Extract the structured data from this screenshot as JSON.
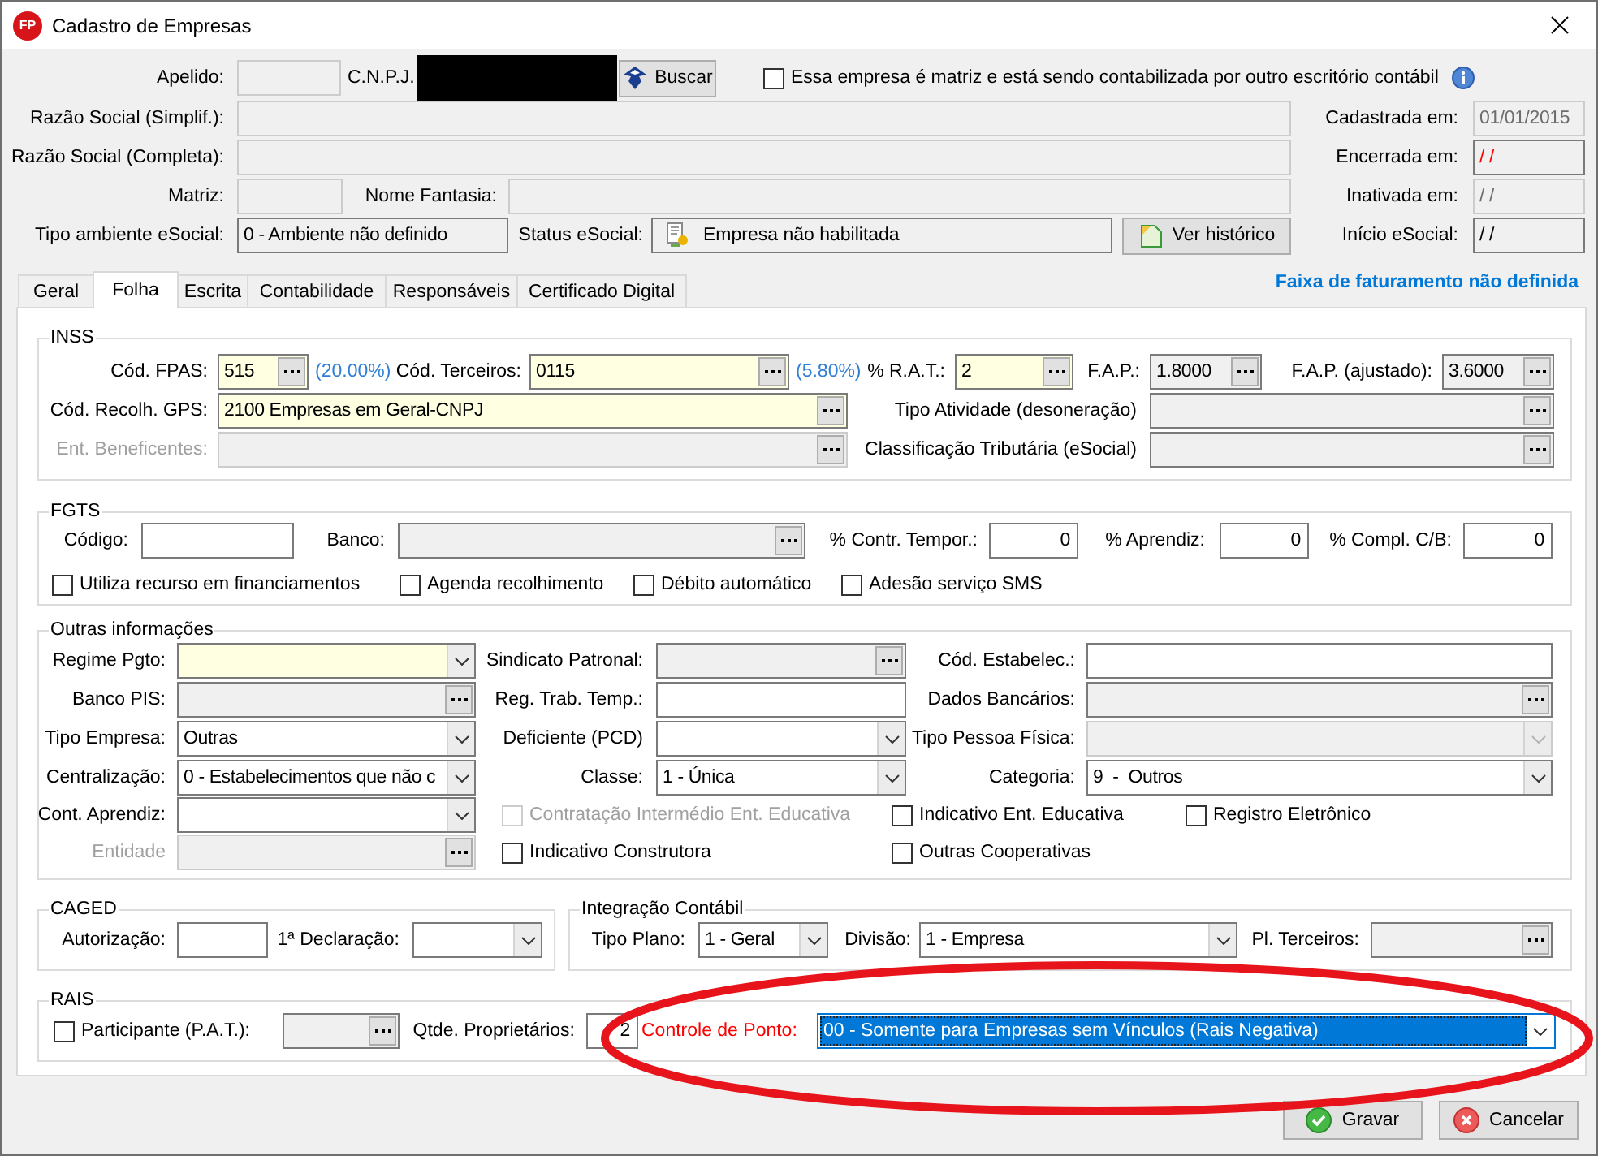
{
  "window": {
    "logo": "FP",
    "title": "Cadastro de Empresas"
  },
  "header": {
    "apelido": {
      "label": "Apelido:",
      "readonly": true,
      "disabled": true
    },
    "cnpj": {
      "label": "C.N.P.J.",
      "redacted": true
    },
    "search_button": {
      "label": "Buscar"
    },
    "matriz_option": {
      "label": "Essa empresa é matriz e está sendo contabilizada por outro escritório contábil",
      "checked": false
    },
    "razao_simplificada": {
      "label": "Razão Social (Simplif.):",
      "readonly": true,
      "disabled": true
    },
    "razao_completa": {
      "label": "Razão Social (Completa):",
      "readonly": true,
      "disabled": true
    },
    "matriz": {
      "label": "Matriz:",
      "readonly": true,
      "disabled": true
    },
    "nome_fantasia": {
      "label": "Nome Fantasia:",
      "readonly": true,
      "disabled": true
    },
    "tipo_ambiente": {
      "label": "Tipo ambiente eSocial:",
      "value": "0 - Ambiente não definido",
      "readonly": true,
      "disabled": false
    },
    "status_esocial": {
      "label": "Status eSocial:",
      "value": "Empresa não habilitada"
    },
    "history_button": {
      "label": "Ver histórico"
    },
    "dates": [
      {
        "label": "Cadastrada em:",
        "value": "01/01/2015",
        "readonly": true,
        "disabled": true,
        "alert": false
      },
      {
        "label": "Encerrada em:",
        "value": "/ /",
        "readonly": true,
        "disabled": false,
        "alert": true
      },
      {
        "label": "Inativada em:",
        "value": "/ /",
        "readonly": true,
        "disabled": true,
        "alert": false
      },
      {
        "label": "Início eSocial:",
        "value": "/ /",
        "readonly": true,
        "disabled": false,
        "alert": false
      }
    ]
  },
  "tabs": [
    {
      "label": "Geral",
      "selected": false
    },
    {
      "label": "Folha",
      "selected": true
    },
    {
      "label": "Escrita",
      "selected": false
    },
    {
      "label": "Contabilidade",
      "selected": false
    },
    {
      "label": "Responsáveis",
      "selected": false
    },
    {
      "label": "Certificado Digital",
      "selected": false
    }
  ],
  "billing_notice": "Faixa de faturamento não definida",
  "inss": {
    "title": "INSS",
    "rows": [
      [
        {
          "kind": "lookup",
          "label": "Cód. FPAS:",
          "value": "515",
          "required": true,
          "readonly": false,
          "disabled": false,
          "note": "(20.00%)",
          "label_dimmed": false
        },
        {
          "kind": "lookup",
          "label": "Cód. Terceiros:",
          "value": "0115",
          "required": true,
          "readonly": false,
          "disabled": false,
          "note": "(5.80%)",
          "label_dimmed": false
        },
        {
          "kind": "lookup",
          "label": "% R.A.T.:",
          "value": "2",
          "required": true,
          "readonly": false,
          "disabled": false,
          "label_dimmed": false
        },
        {
          "kind": "lookup",
          "label": "F.A.P.:",
          "value": "1.8000",
          "required": false,
          "readonly": true,
          "disabled": false,
          "label_dimmed": false
        },
        {
          "kind": "lookup",
          "label": "F.A.P. (ajustado):",
          "value": "3.6000",
          "required": false,
          "readonly": true,
          "disabled": false,
          "label_dimmed": false
        }
      ],
      [
        {
          "kind": "lookup",
          "label": "Cód. Recolh. GPS:",
          "value": "2100 Empresas em Geral-CNPJ",
          "required": true,
          "readonly": false,
          "disabled": false,
          "label_dimmed": false
        },
        {
          "kind": "lookup",
          "label": "Tipo Atividade (desoneração)",
          "required": false,
          "readonly": true,
          "disabled": false,
          "label_dimmed": false
        }
      ],
      [
        {
          "kind": "lookup",
          "label": "Ent. Beneficentes:",
          "required": false,
          "readonly": true,
          "disabled": true,
          "label_dimmed": true
        },
        {
          "kind": "lookup",
          "label": "Classificação Tributária (eSocial)",
          "required": false,
          "readonly": true,
          "disabled": false,
          "label_dimmed": false
        }
      ]
    ]
  },
  "fgts": {
    "title": "FGTS",
    "fields": [
      {
        "kind": "text",
        "label": "Código:",
        "required": false,
        "readonly": false,
        "disabled": false
      },
      {
        "kind": "lookup",
        "label": "Banco:",
        "required": false,
        "readonly": true,
        "disabled": false
      },
      {
        "kind": "number",
        "label": "% Contr. Tempor.:",
        "value": "0",
        "required": false,
        "readonly": false,
        "disabled": false
      },
      {
        "kind": "number",
        "label": "% Aprendiz:",
        "value": "0",
        "required": false,
        "readonly": false,
        "disabled": false
      },
      {
        "kind": "number",
        "label": "% Compl. C/B:",
        "value": "0",
        "required": false,
        "readonly": false,
        "disabled": false
      }
    ],
    "options": [
      {
        "label": "Utiliza recurso em financiamentos",
        "checked": false
      },
      {
        "label": "Agenda recolhimento",
        "checked": false
      },
      {
        "label": "Débito automático",
        "checked": false
      },
      {
        "label": "Adesão serviço SMS",
        "checked": false
      }
    ]
  },
  "outras": {
    "title": "Outras informações",
    "rows": [
      [
        {
          "kind": "select",
          "label": "Regime Pgto:",
          "required": true,
          "readonly": false,
          "disabled": false,
          "label_dimmed": false
        },
        {
          "kind": "lookup",
          "label": "Sindicato Patronal:",
          "required": false,
          "readonly": true,
          "disabled": false,
          "label_dimmed": false
        },
        {
          "kind": "text",
          "label": "Cód. Estabelec.:",
          "required": false,
          "readonly": false,
          "disabled": false,
          "label_dimmed": false
        }
      ],
      [
        {
          "kind": "lookup",
          "label": "Banco PIS:",
          "required": false,
          "readonly": true,
          "disabled": false,
          "label_dimmed": false
        },
        {
          "kind": "text",
          "label": "Reg. Trab. Temp.:",
          "required": false,
          "readonly": false,
          "disabled": false,
          "label_dimmed": false
        },
        {
          "kind": "lookup",
          "label": "Dados Bancários:",
          "required": false,
          "readonly": true,
          "disabled": false,
          "label_dimmed": false
        }
      ],
      [
        {
          "kind": "select",
          "label": "Tipo Empresa:",
          "value": "Outras",
          "required": false,
          "readonly": false,
          "disabled": false,
          "label_dimmed": false
        },
        {
          "kind": "select",
          "label": "Deficiente (PCD)",
          "required": false,
          "readonly": false,
          "disabled": false,
          "label_dimmed": false
        },
        {
          "kind": "select",
          "label": "Tipo Pessoa Física:",
          "required": false,
          "readonly": true,
          "disabled": true,
          "label_dimmed": false
        }
      ],
      [
        {
          "kind": "select",
          "label": "Centralização:",
          "value": "0 - Estabelecimentos que não c",
          "required": false,
          "readonly": false,
          "disabled": false,
          "label_dimmed": false
        },
        {
          "kind": "select",
          "label": "Classe:",
          "value": "1 - Única",
          "required": false,
          "readonly": false,
          "disabled": false,
          "label_dimmed": false
        },
        {
          "kind": "select",
          "label": "Categoria:",
          "value": "9  -  Outros",
          "required": false,
          "readonly": false,
          "disabled": false,
          "label_dimmed": false
        }
      ],
      [
        {
          "kind": "select",
          "label": "Cont. Aprendiz:",
          "required": false,
          "readonly": false,
          "disabled": false,
          "label_dimmed": false
        },
        {
          "kind": "checkbox",
          "label": "Contratação Intermédio Ent. Educativa",
          "checked": false,
          "disabled": true
        },
        {
          "kind": "checkbox",
          "label": "Indicativo Ent. Educativa",
          "checked": false,
          "disabled": false
        },
        {
          "kind": "checkbox",
          "label": "Registro Eletrônico",
          "checked": false,
          "disabled": false
        }
      ],
      [
        {
          "kind": "lookup",
          "label": "Entidade",
          "required": false,
          "readonly": true,
          "disabled": true,
          "label_dimmed": true
        },
        {
          "kind": "checkbox",
          "label": "Indicativo Construtora",
          "checked": false,
          "disabled": false
        },
        {
          "kind": "checkbox",
          "label": "Outras Cooperativas",
          "checked": false,
          "disabled": false
        }
      ]
    ]
  },
  "caged": {
    "title": "CAGED",
    "fields": [
      {
        "kind": "text",
        "label": "Autorização:",
        "required": false,
        "readonly": false,
        "disabled": false
      },
      {
        "kind": "select",
        "label": "1ª Declaração:",
        "required": false,
        "readonly": false,
        "disabled": false
      }
    ]
  },
  "integracao": {
    "title": "Integração Contábil",
    "fields": [
      {
        "kind": "select",
        "label": "Tipo Plano:",
        "value": "1 - Geral",
        "required": false,
        "readonly": false,
        "disabled": false
      },
      {
        "kind": "select",
        "label": "Divisão:",
        "value": "1 - Empresa",
        "required": false,
        "readonly": false,
        "disabled": false
      },
      {
        "kind": "lookup",
        "label": "Pl. Terceiros:",
        "required": false,
        "readonly": true,
        "disabled": false
      }
    ]
  },
  "rais": {
    "title": "RAIS",
    "participant": {
      "label": "Participante (P.A.T.):",
      "checked": false
    },
    "pat_field": {
      "kind": "lookup",
      "required": false,
      "readonly": true,
      "disabled": false
    },
    "owners": {
      "kind": "number",
      "label": "Qtde. Proprietários:",
      "value": "2",
      "required": false,
      "readonly": false,
      "disabled": false
    },
    "time_control": {
      "label": "Controle de Ponto:",
      "label_alert": true,
      "value": "00 - Somente para Empresas sem Vínculos (Rais Negativa)",
      "focused": true
    }
  },
  "buttons": [
    {
      "kind": "save",
      "label": "Gravar"
    },
    {
      "kind": "cancel",
      "label": "Cancelar"
    }
  ],
  "annotation": {
    "kind": "ellipse"
  }
}
